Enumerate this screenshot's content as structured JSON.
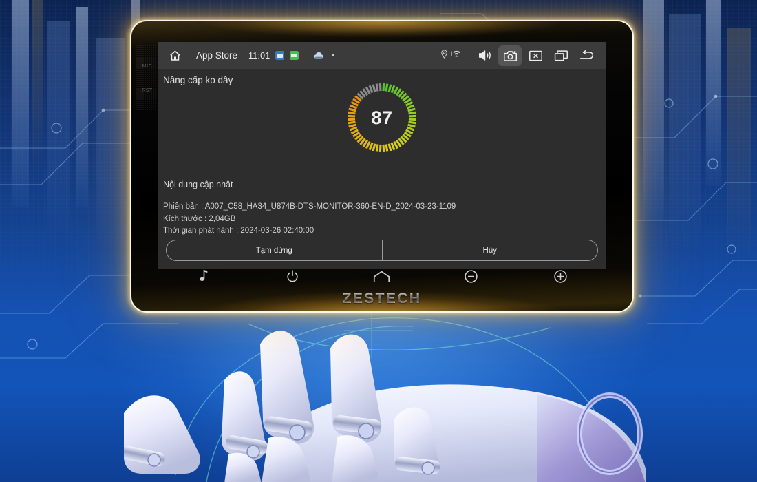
{
  "background": {
    "scene_description": "blue futuristic city with circuit traces and a robotic hand holding the device",
    "accent_blue": "#1551b2",
    "glow_amber": "#ffbe46"
  },
  "device": {
    "brand": "ZESTECH",
    "bezel_labels": {
      "mic": "MIC",
      "reset": "RST"
    },
    "hardware_buttons": [
      {
        "name": "music-button",
        "icon": "music-note-icon"
      },
      {
        "name": "power-button",
        "icon": "power-icon"
      },
      {
        "name": "home-button",
        "icon": "home-outline-icon"
      },
      {
        "name": "volume-down-button",
        "icon": "minus-circle-icon"
      },
      {
        "name": "volume-up-button",
        "icon": "plus-circle-icon"
      }
    ]
  },
  "statusbar": {
    "home_icon": "home-icon",
    "app_label": "App Store",
    "time": "11:01",
    "notif_icons": [
      "app-icon-blue",
      "app-icon-green",
      "cloud-icon",
      "dot-indicator"
    ],
    "indicator_icons": [
      "location-pin-icon",
      "wifi-icon"
    ],
    "buttons": [
      {
        "name": "volume-icon",
        "label": "volume-icon",
        "selected": false
      },
      {
        "name": "screenshot-icon",
        "label": "camera-icon",
        "selected": true
      },
      {
        "name": "close-icon",
        "label": "close-box-icon",
        "selected": false
      },
      {
        "name": "recents-icon",
        "label": "recent-apps-icon",
        "selected": false
      },
      {
        "name": "back-icon",
        "label": "back-arrow-icon",
        "selected": false
      }
    ]
  },
  "screen": {
    "title": "Nâng cấp ko dây",
    "progress": {
      "value": 87,
      "unit": "%",
      "total_segments": 60,
      "colors": {
        "start": "#e8920f",
        "mid": "#d8d01a",
        "end": "#55c72c",
        "empty": "#8d8d8d"
      }
    },
    "content_heading": "Nội dung cập nhật",
    "details": [
      "Phiên bản : A007_C58_HA34_U874B-DTS-MONITOR-360-EN-D_2024-03-23-1109",
      "Kích thước : 2,04GB",
      "Thời gian phát hành : 2024-03-26 02:40:00"
    ],
    "actions": [
      {
        "name": "pause-button",
        "label": "Tạm dừng"
      },
      {
        "name": "cancel-button",
        "label": "Hủy"
      }
    ]
  }
}
